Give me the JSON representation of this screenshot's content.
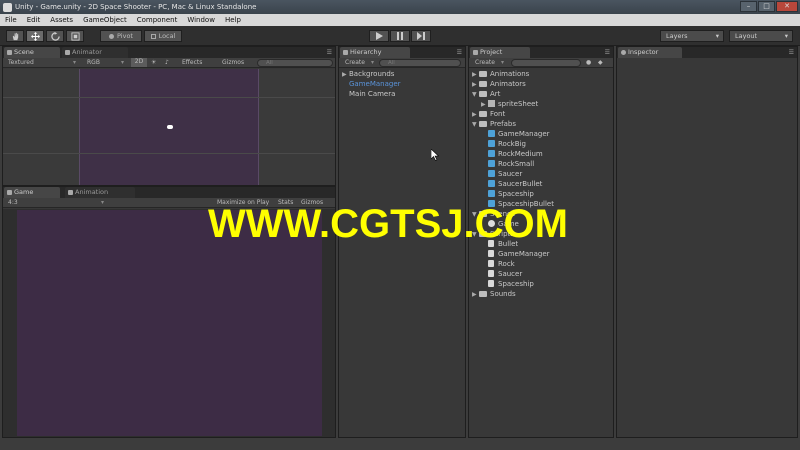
{
  "window": {
    "title": "Unity - Game.unity - 2D Space Shooter - PC, Mac & Linux Standalone",
    "controls": [
      "–",
      "□",
      "✕"
    ]
  },
  "menu": [
    "File",
    "Edit",
    "Assets",
    "GameObject",
    "Component",
    "Window",
    "Help"
  ],
  "toolbar": {
    "pivot": "Pivot",
    "local": "Local",
    "layers": "Layers",
    "layout": "Layout"
  },
  "scene": {
    "tabs": [
      "Scene",
      "Animator"
    ],
    "shading": "Textured",
    "render": "RGB",
    "mode2d": "2D",
    "effects": "Effects",
    "gizmos": "Gizmos",
    "search": "All"
  },
  "game": {
    "tabs": [
      "Game",
      "Animation"
    ],
    "aspect": "4:3",
    "maximize": "Maximize on Play",
    "stats": "Stats",
    "gizmos": "Gizmos"
  },
  "hierarchy": {
    "tab": "Hierarchy",
    "create": "Create",
    "search": "All",
    "items": [
      {
        "label": "Backgrounds",
        "expandable": true,
        "selected": false
      },
      {
        "label": "GameManager",
        "expandable": false,
        "selected": true
      },
      {
        "label": "Main Camera",
        "expandable": false,
        "selected": false
      }
    ]
  },
  "project": {
    "tab": "Project",
    "create": "Create",
    "items": [
      {
        "label": "Animations",
        "type": "folder",
        "depth": 0,
        "arrow": "▶"
      },
      {
        "label": "Animators",
        "type": "folder",
        "depth": 0,
        "arrow": "▶"
      },
      {
        "label": "Art",
        "type": "folder",
        "depth": 0,
        "arrow": "▼"
      },
      {
        "label": "spriteSheet",
        "type": "sprite",
        "depth": 1,
        "arrow": "▶"
      },
      {
        "label": "Font",
        "type": "folder",
        "depth": 0,
        "arrow": "▶"
      },
      {
        "label": "Prefabs",
        "type": "folder",
        "depth": 0,
        "arrow": "▼"
      },
      {
        "label": "GameManager",
        "type": "prefab",
        "depth": 1,
        "arrow": ""
      },
      {
        "label": "RockBig",
        "type": "prefab",
        "depth": 1,
        "arrow": ""
      },
      {
        "label": "RockMedium",
        "type": "prefab",
        "depth": 1,
        "arrow": ""
      },
      {
        "label": "RockSmall",
        "type": "prefab",
        "depth": 1,
        "arrow": ""
      },
      {
        "label": "Saucer",
        "type": "prefab",
        "depth": 1,
        "arrow": ""
      },
      {
        "label": "SaucerBullet",
        "type": "prefab",
        "depth": 1,
        "arrow": ""
      },
      {
        "label": "Spaceship",
        "type": "prefab",
        "depth": 1,
        "arrow": ""
      },
      {
        "label": "SpaceshipBullet",
        "type": "prefab",
        "depth": 1,
        "arrow": ""
      },
      {
        "label": "Scenes",
        "type": "folder",
        "depth": 0,
        "arrow": "▼"
      },
      {
        "label": "Game",
        "type": "scene",
        "depth": 1,
        "arrow": ""
      },
      {
        "label": "Scripts",
        "type": "folder",
        "depth": 0,
        "arrow": "▼"
      },
      {
        "label": "Bullet",
        "type": "script",
        "depth": 1,
        "arrow": ""
      },
      {
        "label": "GameManager",
        "type": "script",
        "depth": 1,
        "arrow": ""
      },
      {
        "label": "Rock",
        "type": "script",
        "depth": 1,
        "arrow": ""
      },
      {
        "label": "Saucer",
        "type": "script",
        "depth": 1,
        "arrow": ""
      },
      {
        "label": "Spaceship",
        "type": "script",
        "depth": 1,
        "arrow": ""
      },
      {
        "label": "Sounds",
        "type": "folder",
        "depth": 0,
        "arrow": "▶"
      }
    ]
  },
  "inspector": {
    "tab": "Inspector"
  },
  "watermark": "WWW.CGTSJ.COM",
  "colors": {
    "scene_bg": "#3f3047",
    "game_bg": "#3d2c45",
    "selection": "#5a93d8",
    "watermark": "#ffff00"
  }
}
